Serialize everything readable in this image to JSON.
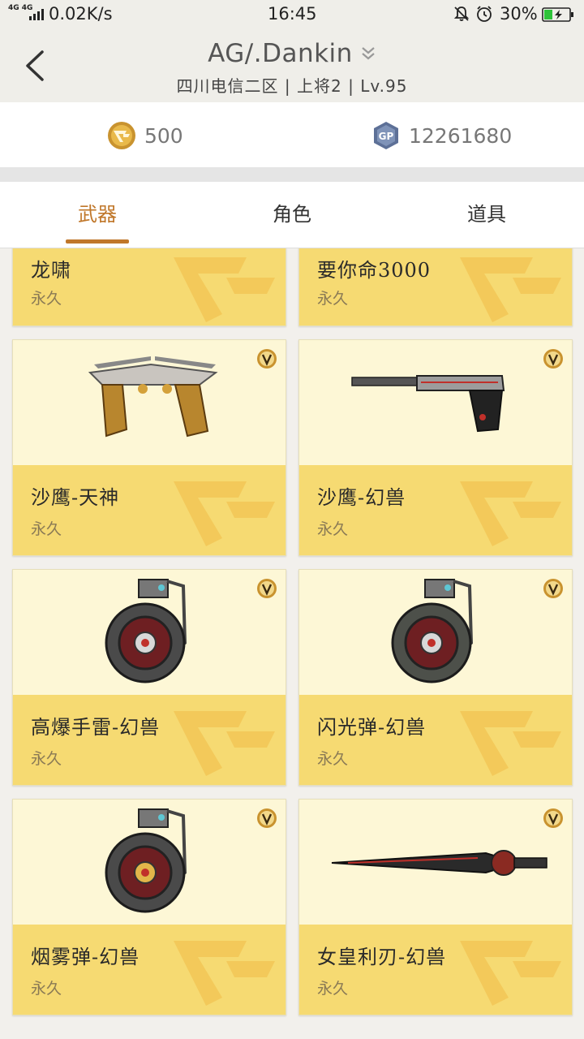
{
  "status_bar": {
    "network": "4G 4G",
    "speed": "0.02K/s",
    "time": "16:45",
    "battery": "30%",
    "icons": [
      "signal-icon",
      "mute-bell-icon",
      "alarm-icon",
      "battery-charging-icon"
    ]
  },
  "header": {
    "title": "AG/.Dankin",
    "subtitle": "四川电信二区 | 上将2 | Lv.95",
    "back_icon": "back-arrow-icon",
    "dropdown_icon": "double-chevron-down-icon"
  },
  "currency": {
    "cf_points": "500",
    "gp": "12261680",
    "gp_label": "GP"
  },
  "tabs": [
    {
      "label": "武器",
      "active": true
    },
    {
      "label": "角色",
      "active": false
    },
    {
      "label": "道具",
      "active": false
    }
  ],
  "items": [
    {
      "name": "龙啸",
      "duration": "永久",
      "vip": false,
      "weapon": "none"
    },
    {
      "name": "要你命3000",
      "duration": "永久",
      "vip": false,
      "weapon": "none"
    },
    {
      "name": "沙鹰-天神",
      "duration": "永久",
      "vip": true,
      "weapon": "dual-pistols-image"
    },
    {
      "name": "沙鹰-幻兽",
      "duration": "永久",
      "vip": true,
      "weapon": "pistol-image"
    },
    {
      "name": "高爆手雷-幻兽",
      "duration": "永久",
      "vip": true,
      "weapon": "grenade-image"
    },
    {
      "name": "闪光弹-幻兽",
      "duration": "永久",
      "vip": true,
      "weapon": "grenade-image"
    },
    {
      "name": "烟雾弹-幻兽",
      "duration": "永久",
      "vip": true,
      "weapon": "grenade-image"
    },
    {
      "name": "女皇利刃-幻兽",
      "duration": "永久",
      "vip": true,
      "weapon": "knife-image"
    }
  ],
  "colors": {
    "accent": "#c0772a",
    "card_top": "#fdf7d6",
    "card_bottom": "#f6da72"
  }
}
